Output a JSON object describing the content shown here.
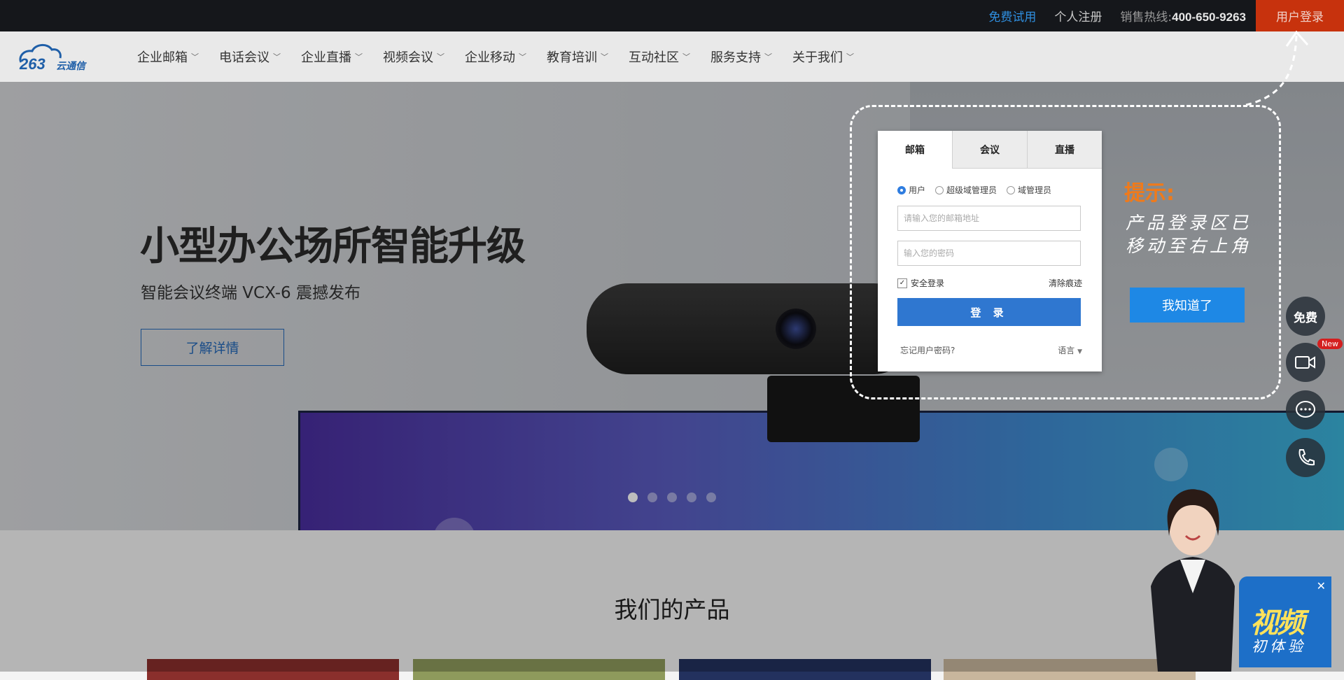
{
  "topbar": {
    "trial": "免费试用",
    "register": "个人注册",
    "hotline_label": "销售热线:",
    "hotline_number": "400-650-9263",
    "login": "用户登录"
  },
  "nav": {
    "logo_text": "263云通信",
    "items": [
      {
        "label": "企业邮箱"
      },
      {
        "label": "电话会议"
      },
      {
        "label": "企业直播"
      },
      {
        "label": "视频会议"
      },
      {
        "label": "企业移动"
      },
      {
        "label": "教育培训"
      },
      {
        "label": "互动社区"
      },
      {
        "label": "服务支持"
      },
      {
        "label": "关于我们"
      }
    ]
  },
  "hero": {
    "title": "小型办公场所智能升级",
    "subtitle": "智能会议终端 VCX-6 震撼发布",
    "detail_button": "了解详情",
    "slides": 5,
    "active_slide": 1
  },
  "products": {
    "title": "我们的产品"
  },
  "login_panel": {
    "tabs": [
      "邮箱",
      "会议",
      "直播"
    ],
    "active_tab": 0,
    "roles": [
      "用户",
      "超级域管理员",
      "域管理员"
    ],
    "selected_role": 0,
    "email_placeholder": "请输入您的邮箱地址",
    "password_placeholder": "输入您的密码",
    "secure_login": "安全登录",
    "secure_checked": true,
    "clear_trace": "清除痕迹",
    "submit": "登 录",
    "forgot": "忘记用户密码?",
    "language": "语言"
  },
  "tip": {
    "title": "提示:",
    "line1": "产品登录区已",
    "line2": "移动至右上角",
    "ok_button": "我知道了"
  },
  "side_buttons": {
    "free": "免费",
    "new_badge": "New"
  },
  "promo": {
    "big": "视频",
    "small": "初体验"
  },
  "colors": {
    "topbar": "#15171b",
    "login_accent": "#c7320d",
    "link_blue": "#2f8fe0",
    "tip_orange": "#f07a1a",
    "button_blue": "#2f77d0"
  }
}
